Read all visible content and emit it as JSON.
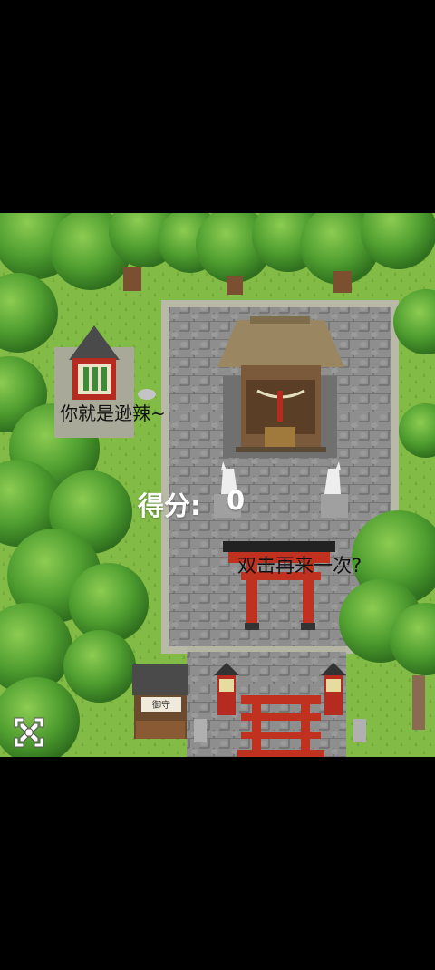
{
  "game": {
    "message": "你就是逊辣~",
    "score_label": "得分:",
    "score_value": "0",
    "retry_prompt": "双击再来一次?",
    "shrine_sign": "御守",
    "icons": {
      "fullscreen": "fullscreen-toggle-icon"
    },
    "colors": {
      "grass": "#7fb842",
      "tree": "#4a9a2e",
      "stone": "#8c8c8c",
      "torii": "#c0321f",
      "roof": "#9a8660"
    }
  }
}
